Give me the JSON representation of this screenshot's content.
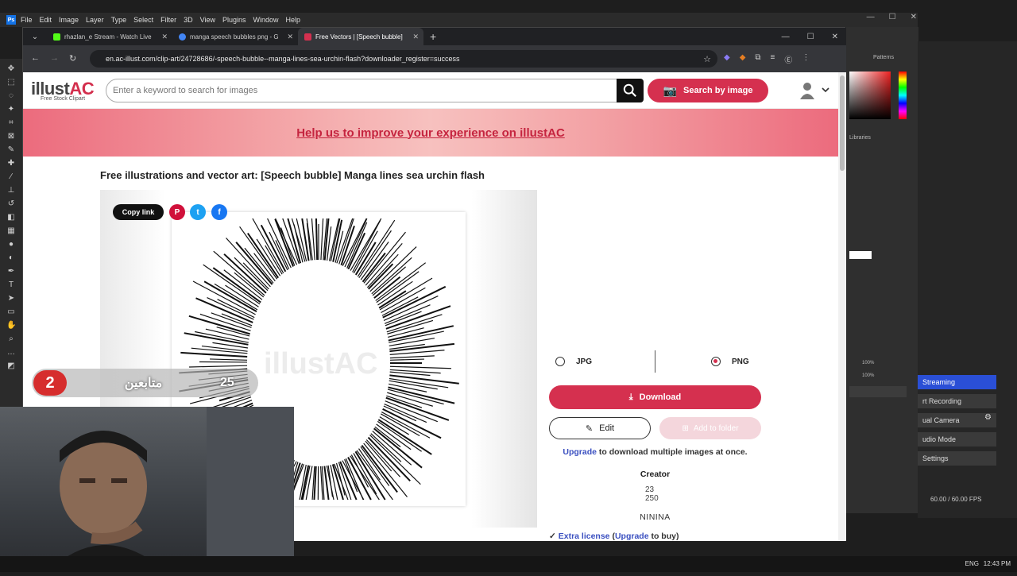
{
  "photoshop": {
    "menu": [
      "File",
      "Edit",
      "Image",
      "Layer",
      "Type",
      "Select",
      "Filter",
      "3D",
      "View",
      "Plugins",
      "Window",
      "Help"
    ],
    "panel_labels": {
      "patterns": "Patterns",
      "libraries": "Libraries"
    },
    "opacity": "100%",
    "fill": "100%"
  },
  "browser": {
    "tabs": [
      {
        "title": "rhazlan_e Stream - Watch Live",
        "color": "#53fc18"
      },
      {
        "title": "manga speech bubbles png - G",
        "color": "#4285f4"
      },
      {
        "title": "Free Vectors | [Speech bubble]",
        "color": "#d5304f"
      }
    ],
    "url": "en.ac-illust.com/clip-art/24728686/-speech-bubble--manga-lines-sea-urchin-flash?downloader_register=success"
  },
  "site": {
    "logo_main": "illust",
    "logo_ac": "AC",
    "logo_sub": "Free Stock Clipart",
    "search_placeholder": "Enter a keyword to search for images",
    "search_by_image": "Search by image",
    "banner_text": "Help us to improve your experience on illustAC",
    "page_title": "Free illustrations and vector art: [Speech bubble] Manga lines sea urchin flash",
    "copy_link": "Copy link",
    "watermark": "illustAC",
    "formats": [
      {
        "label": "JPG",
        "selected": false
      },
      {
        "label": "PNG",
        "selected": true
      }
    ],
    "download": "Download",
    "edit": "Edit",
    "add_to_folder": "Add to folder",
    "upgrade_link": "Upgrade",
    "upgrade_text": " to download multiple images at once.",
    "creator_label": "Creator",
    "creator_img_alt": "23 250",
    "creator_name": "NININA",
    "extra_license": "Extra license",
    "extra_upgrade": "Upgrade",
    "extra_suffix": " to buy)"
  },
  "stream_overlay": {
    "badge": "2",
    "label": "متابعين",
    "count": "25"
  },
  "obs": {
    "items": [
      "Streaming",
      "rt Recording",
      "ual Camera",
      "udio Mode",
      "Settings"
    ],
    "fps": "60.00 / 60.00 FPS"
  },
  "taskbar": {
    "lang": "ENG",
    "time": "12:43 PM"
  }
}
